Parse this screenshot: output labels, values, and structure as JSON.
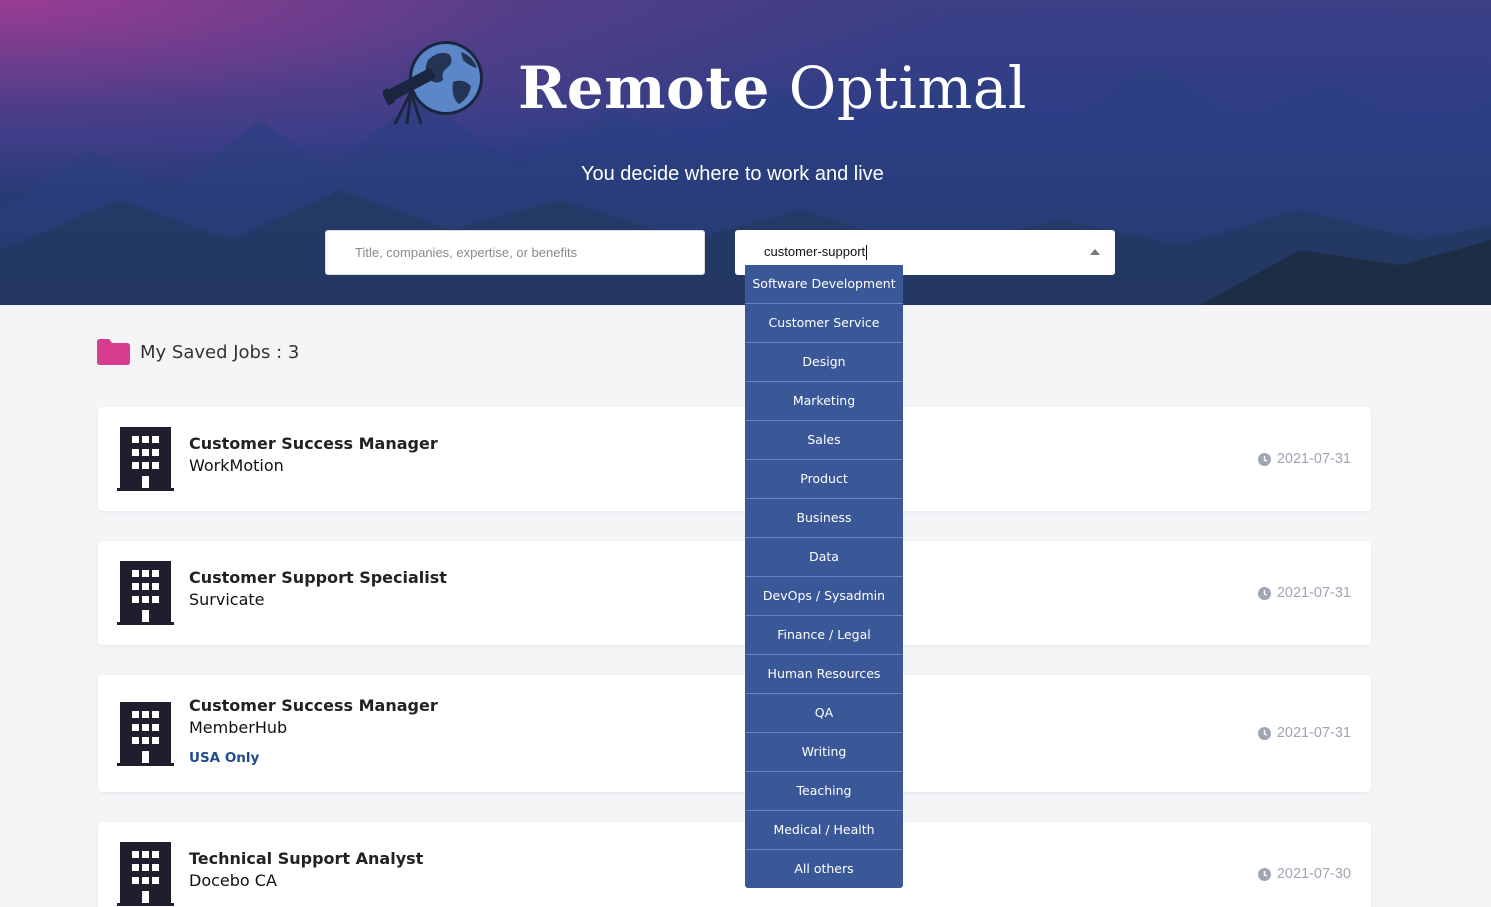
{
  "header": {
    "brand_bold": "Remote",
    "brand_light": "Optimal",
    "tagline": "You decide where to work and live"
  },
  "search": {
    "placeholder": "Title, companies, expertise, or benefits",
    "value": ""
  },
  "category": {
    "value": "customer-support",
    "options": [
      "Software Development",
      "Customer Service",
      "Design",
      "Marketing",
      "Sales",
      "Product",
      "Business",
      "Data",
      "DevOps / Sysadmin",
      "Finance / Legal",
      "Human Resources",
      "QA",
      "Writing",
      "Teaching",
      "Medical / Health",
      "All others"
    ]
  },
  "saved": {
    "label": "My Saved Jobs : 3"
  },
  "jobs": [
    {
      "title": "Customer Success Manager",
      "company": "WorkMotion",
      "location": "",
      "date": "2021-07-31"
    },
    {
      "title": "Customer Support Specialist",
      "company": "Survicate",
      "location": "",
      "date": "2021-07-31"
    },
    {
      "title": "Customer Success Manager",
      "company": "MemberHub",
      "location": "USA Only",
      "date": "2021-07-31"
    },
    {
      "title": "Technical Support Analyst",
      "company": "Docebo CA",
      "location": "",
      "date": "2021-07-30"
    }
  ],
  "colors": {
    "accent": "#3a5898",
    "folder": "#d63d8f",
    "location": "#1e4d8c",
    "date": "#a0a5b5"
  },
  "icons": [
    "telescope-globe-logo",
    "folder-icon",
    "building-icon",
    "clock-icon",
    "caret-up-icon"
  ]
}
